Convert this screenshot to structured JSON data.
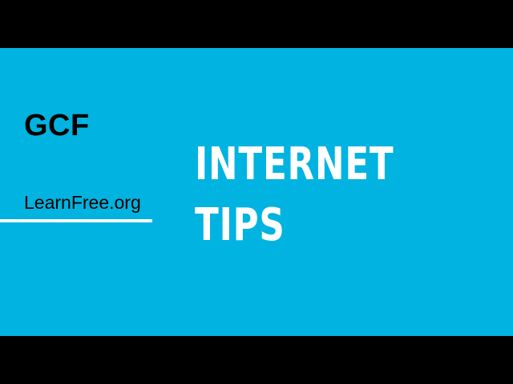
{
  "logo": {
    "brand": "GCF",
    "site": "LearnFree.org"
  },
  "title": {
    "line1": "INTERNET",
    "line2": "TIPS"
  },
  "colors": {
    "panel_background": "#00b3e0",
    "letterbox": "#000000",
    "title_text": "#ffffff",
    "logo_text": "#000000",
    "logo_underline": "#ffffff"
  }
}
